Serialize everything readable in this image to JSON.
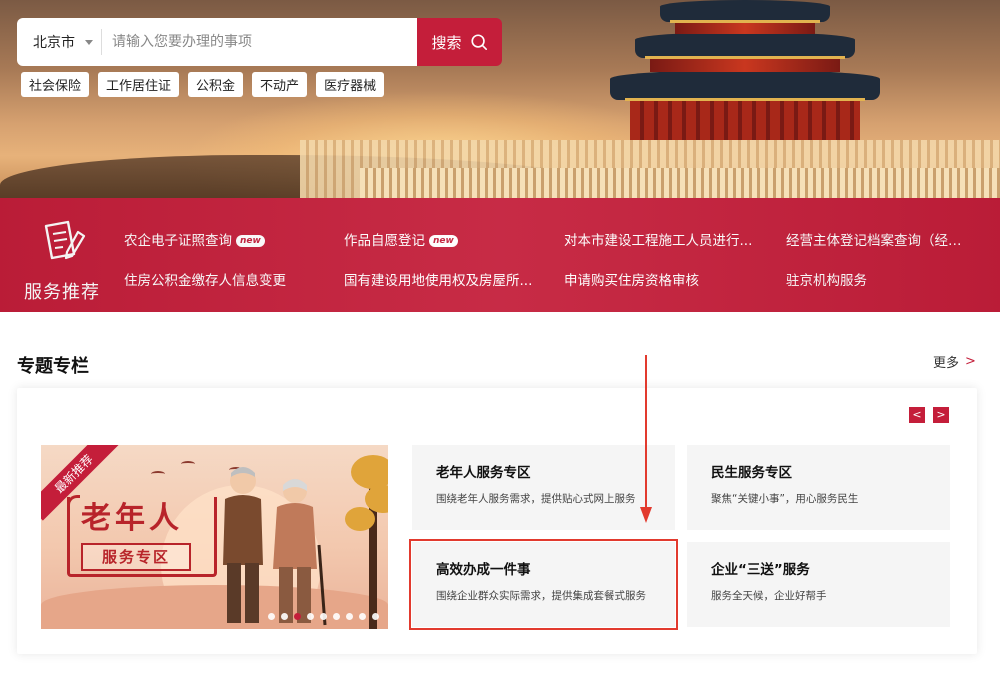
{
  "search": {
    "city": "北京市",
    "placeholder": "请输入您要办理的事项",
    "button_label": "搜索"
  },
  "quick_tags": [
    "社会保险",
    "工作居住证",
    "公积金",
    "不动产",
    "医疗器械"
  ],
  "services": {
    "title": "服务推荐",
    "items": [
      {
        "label": "农企电子证照查询",
        "badge": "new"
      },
      {
        "label": "作品自愿登记",
        "badge": "new"
      },
      {
        "label": "对本市建设工程施工人员进行...",
        "badge": ""
      },
      {
        "label": "经营主体登记档案查询（经营...",
        "badge": ""
      },
      {
        "label": "住房公积金缴存人信息变更",
        "badge": ""
      },
      {
        "label": "国有建设用地使用权及房屋所...",
        "badge": ""
      },
      {
        "label": "申请购买住房资格审核",
        "badge": ""
      },
      {
        "label": "驻京机构服务",
        "badge": ""
      }
    ]
  },
  "section": {
    "title": "专题专栏",
    "more_label": "更多",
    "more_arrow": ">"
  },
  "banner": {
    "ribbon": "最新推荐",
    "main": "老年人",
    "sub": "服务专区",
    "slide_count": 9,
    "active_slide": 3
  },
  "nav": {
    "prev": "<",
    "next": ">"
  },
  "cards": [
    {
      "title": "老年人服务专区",
      "desc": "围绕老年人服务需求，提供贴心式网上服务"
    },
    {
      "title": "民生服务专区",
      "desc": "聚焦“关键小事”，用心服务民生"
    },
    {
      "title": "高效办成一件事",
      "desc": "围绕企业群众实际需求，提供集成套餐式服务",
      "highlighted": true
    },
    {
      "title": "企业“三送”服务",
      "desc": "服务全天候，企业好帮手"
    }
  ],
  "colors": {
    "brand_red": "#c41e3a",
    "highlight_red": "#e23a2e",
    "card_bg": "#f5f5f5"
  }
}
